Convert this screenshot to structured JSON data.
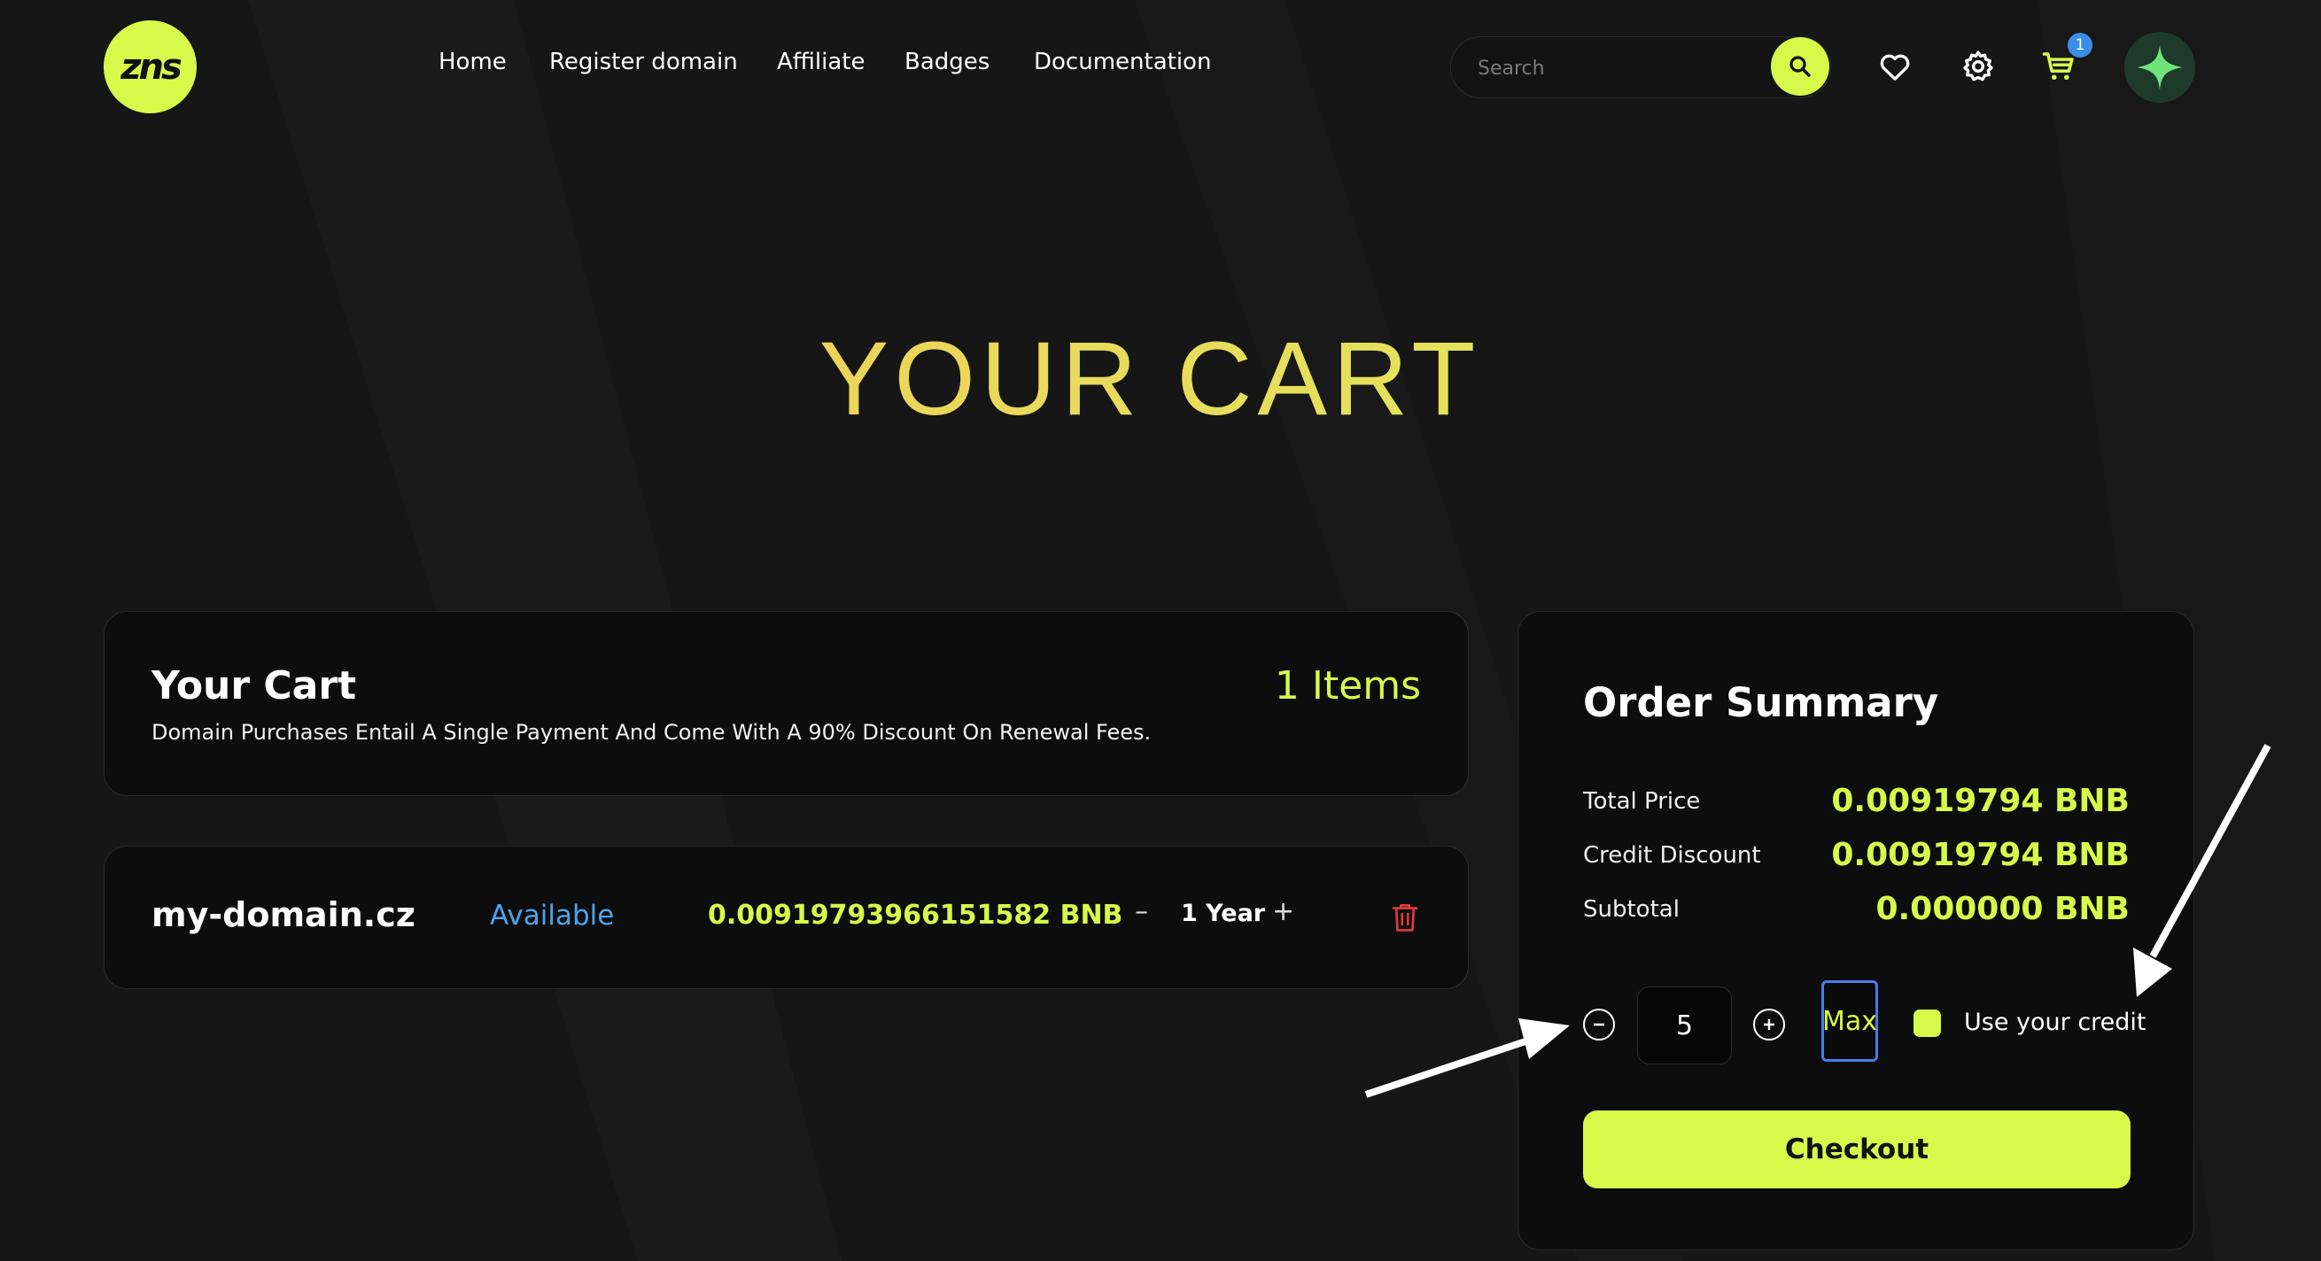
{
  "header": {
    "logo_text": "zns",
    "nav": [
      "Home",
      "Register domain",
      "Affiliate",
      "Badges",
      "Documentation"
    ],
    "search_placeholder": "Search",
    "cart_count": "1",
    "icons": [
      "search-icon",
      "heart-icon",
      "gear-icon",
      "cart-icon",
      "sparkle-avatar-icon"
    ]
  },
  "page_title": "YOUR CART",
  "cart": {
    "title": "Your Cart",
    "count": "1 Items",
    "note": "Domain Purchases Entail A Single Payment And Come With A 90% Discount On Renewal Fees.",
    "items": [
      {
        "domain": "my-domain.cz",
        "status": "Available",
        "price": "0.00919793966151582 BNB",
        "minus": "–",
        "period": "1 Year",
        "plus": "+"
      }
    ]
  },
  "summary": {
    "title": "Order Summary",
    "rows": [
      {
        "label": "Total Price",
        "value": "0.00919794 BNB"
      },
      {
        "label": "Credit Discount",
        "value": "0.00919794 BNB"
      },
      {
        "label": "Subtotal",
        "value": "0.000000 BNB"
      }
    ],
    "credit_qty": "5",
    "max_label": "Max",
    "use_credit_label": "Use your credit",
    "use_credit_checked": true,
    "checkout_label": "Checkout"
  },
  "colors": {
    "accent": "#d7f94a",
    "available": "#4da3ee",
    "delete": "#e23b3b",
    "title_gradient": [
      "#f5c045",
      "#d8f55c"
    ]
  }
}
